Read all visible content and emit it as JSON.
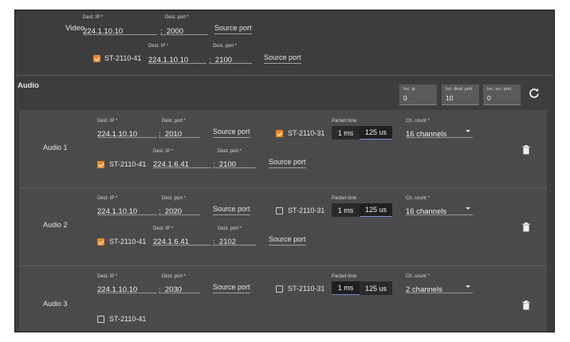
{
  "video": {
    "row_label": "Video",
    "primary": {
      "dest_ip_label": "Dest. IP *",
      "dest_ip": "224.1.10.10",
      "dest_port_label": "Dest. port *",
      "dest_port": "2000",
      "source_port": "Source port"
    },
    "secondary": {
      "checkbox_label": "ST-2110-41",
      "checked": true,
      "dest_ip_label": "Dest. IP *",
      "dest_ip": "224.1.10.10",
      "dest_port_label": "Dest. port *",
      "dest_port": "2100",
      "source_port": "Source port"
    }
  },
  "audio": {
    "title": "Audio",
    "inc_ip_label": "Inc. ip",
    "inc_ip": "0",
    "inc_dest_port_label": "Inc. dest. port",
    "inc_dest_port": "10",
    "inc_src_port_label": "Inc. src. port",
    "inc_src_port": "0",
    "refresh_icon": "refresh-icon",
    "items": [
      {
        "name": "Audio 1",
        "dest_ip_label": "Dest. IP *",
        "dest_ip": "224.1.10.10",
        "dest_port_label": "Dest. port *",
        "dest_port": "2010",
        "source_port": "Source port",
        "st2110_31": {
          "label": "ST-2110-31",
          "checked": true
        },
        "packet_time_label": "Packet time",
        "packet_time_options": [
          "1 ms",
          "125 us"
        ],
        "packet_time_selected": "125 us",
        "ch_count_label": "Ch. count *",
        "ch_count": "16 channels",
        "st2110_41": {
          "label": "ST-2110-41",
          "checked": true,
          "dest_ip_label": "Dest. IP *",
          "dest_ip": "224.1.6.41",
          "dest_port_label": "Dest. port *",
          "dest_port": "2100",
          "source_port": "Source port"
        }
      },
      {
        "name": "Audio 2",
        "dest_ip_label": "Dest. IP *",
        "dest_ip": "224.1.10.10",
        "dest_port_label": "Dest. port *",
        "dest_port": "2020",
        "source_port": "Source port",
        "st2110_31": {
          "label": "ST-2110-31",
          "checked": false
        },
        "packet_time_label": "Packet time",
        "packet_time_options": [
          "1 ms",
          "125 us"
        ],
        "packet_time_selected": "125 us",
        "ch_count_label": "Ch. count *",
        "ch_count": "16 channels",
        "st2110_41": {
          "label": "ST-2110-41",
          "checked": true,
          "dest_ip_label": "Dest. IP *",
          "dest_ip": "224.1.6.41",
          "dest_port_label": "Dest. port *",
          "dest_port": "2102",
          "source_port": "Source port"
        }
      },
      {
        "name": "Audio 3",
        "dest_ip_label": "Dest. IP *",
        "dest_ip": "224.1.10.10",
        "dest_port_label": "Dest. port *",
        "dest_port": "2030",
        "source_port": "Source port",
        "st2110_31": {
          "label": "ST-2110-31",
          "checked": false
        },
        "packet_time_label": "Packet time",
        "packet_time_options": [
          "1 ms",
          "125 us"
        ],
        "packet_time_selected": "1 ms",
        "ch_count_label": "Ch. count *",
        "ch_count": "2 channels",
        "st2110_41": {
          "label": "ST-2110-41",
          "checked": false
        }
      }
    ]
  },
  "colors": {
    "accent": "#e88a2a",
    "panel": "#3d3d3d",
    "section": "#4a4a4a",
    "selected_underline": "#6f8fd0"
  }
}
